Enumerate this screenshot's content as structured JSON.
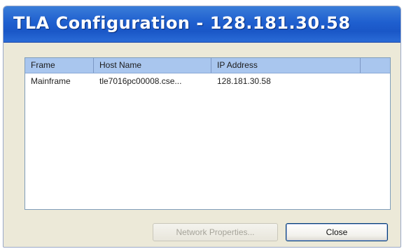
{
  "window": {
    "title": "TLA Configuration - 128.181.30.58"
  },
  "table": {
    "columns": [
      "Frame",
      "Host Name",
      "IP Address"
    ],
    "rows": [
      {
        "frame": "Mainframe",
        "host_name": "tle7016pc00008.cse...",
        "ip_address": "128.181.30.58"
      }
    ]
  },
  "buttons": {
    "network_properties": "Network Properties...",
    "close": "Close"
  }
}
